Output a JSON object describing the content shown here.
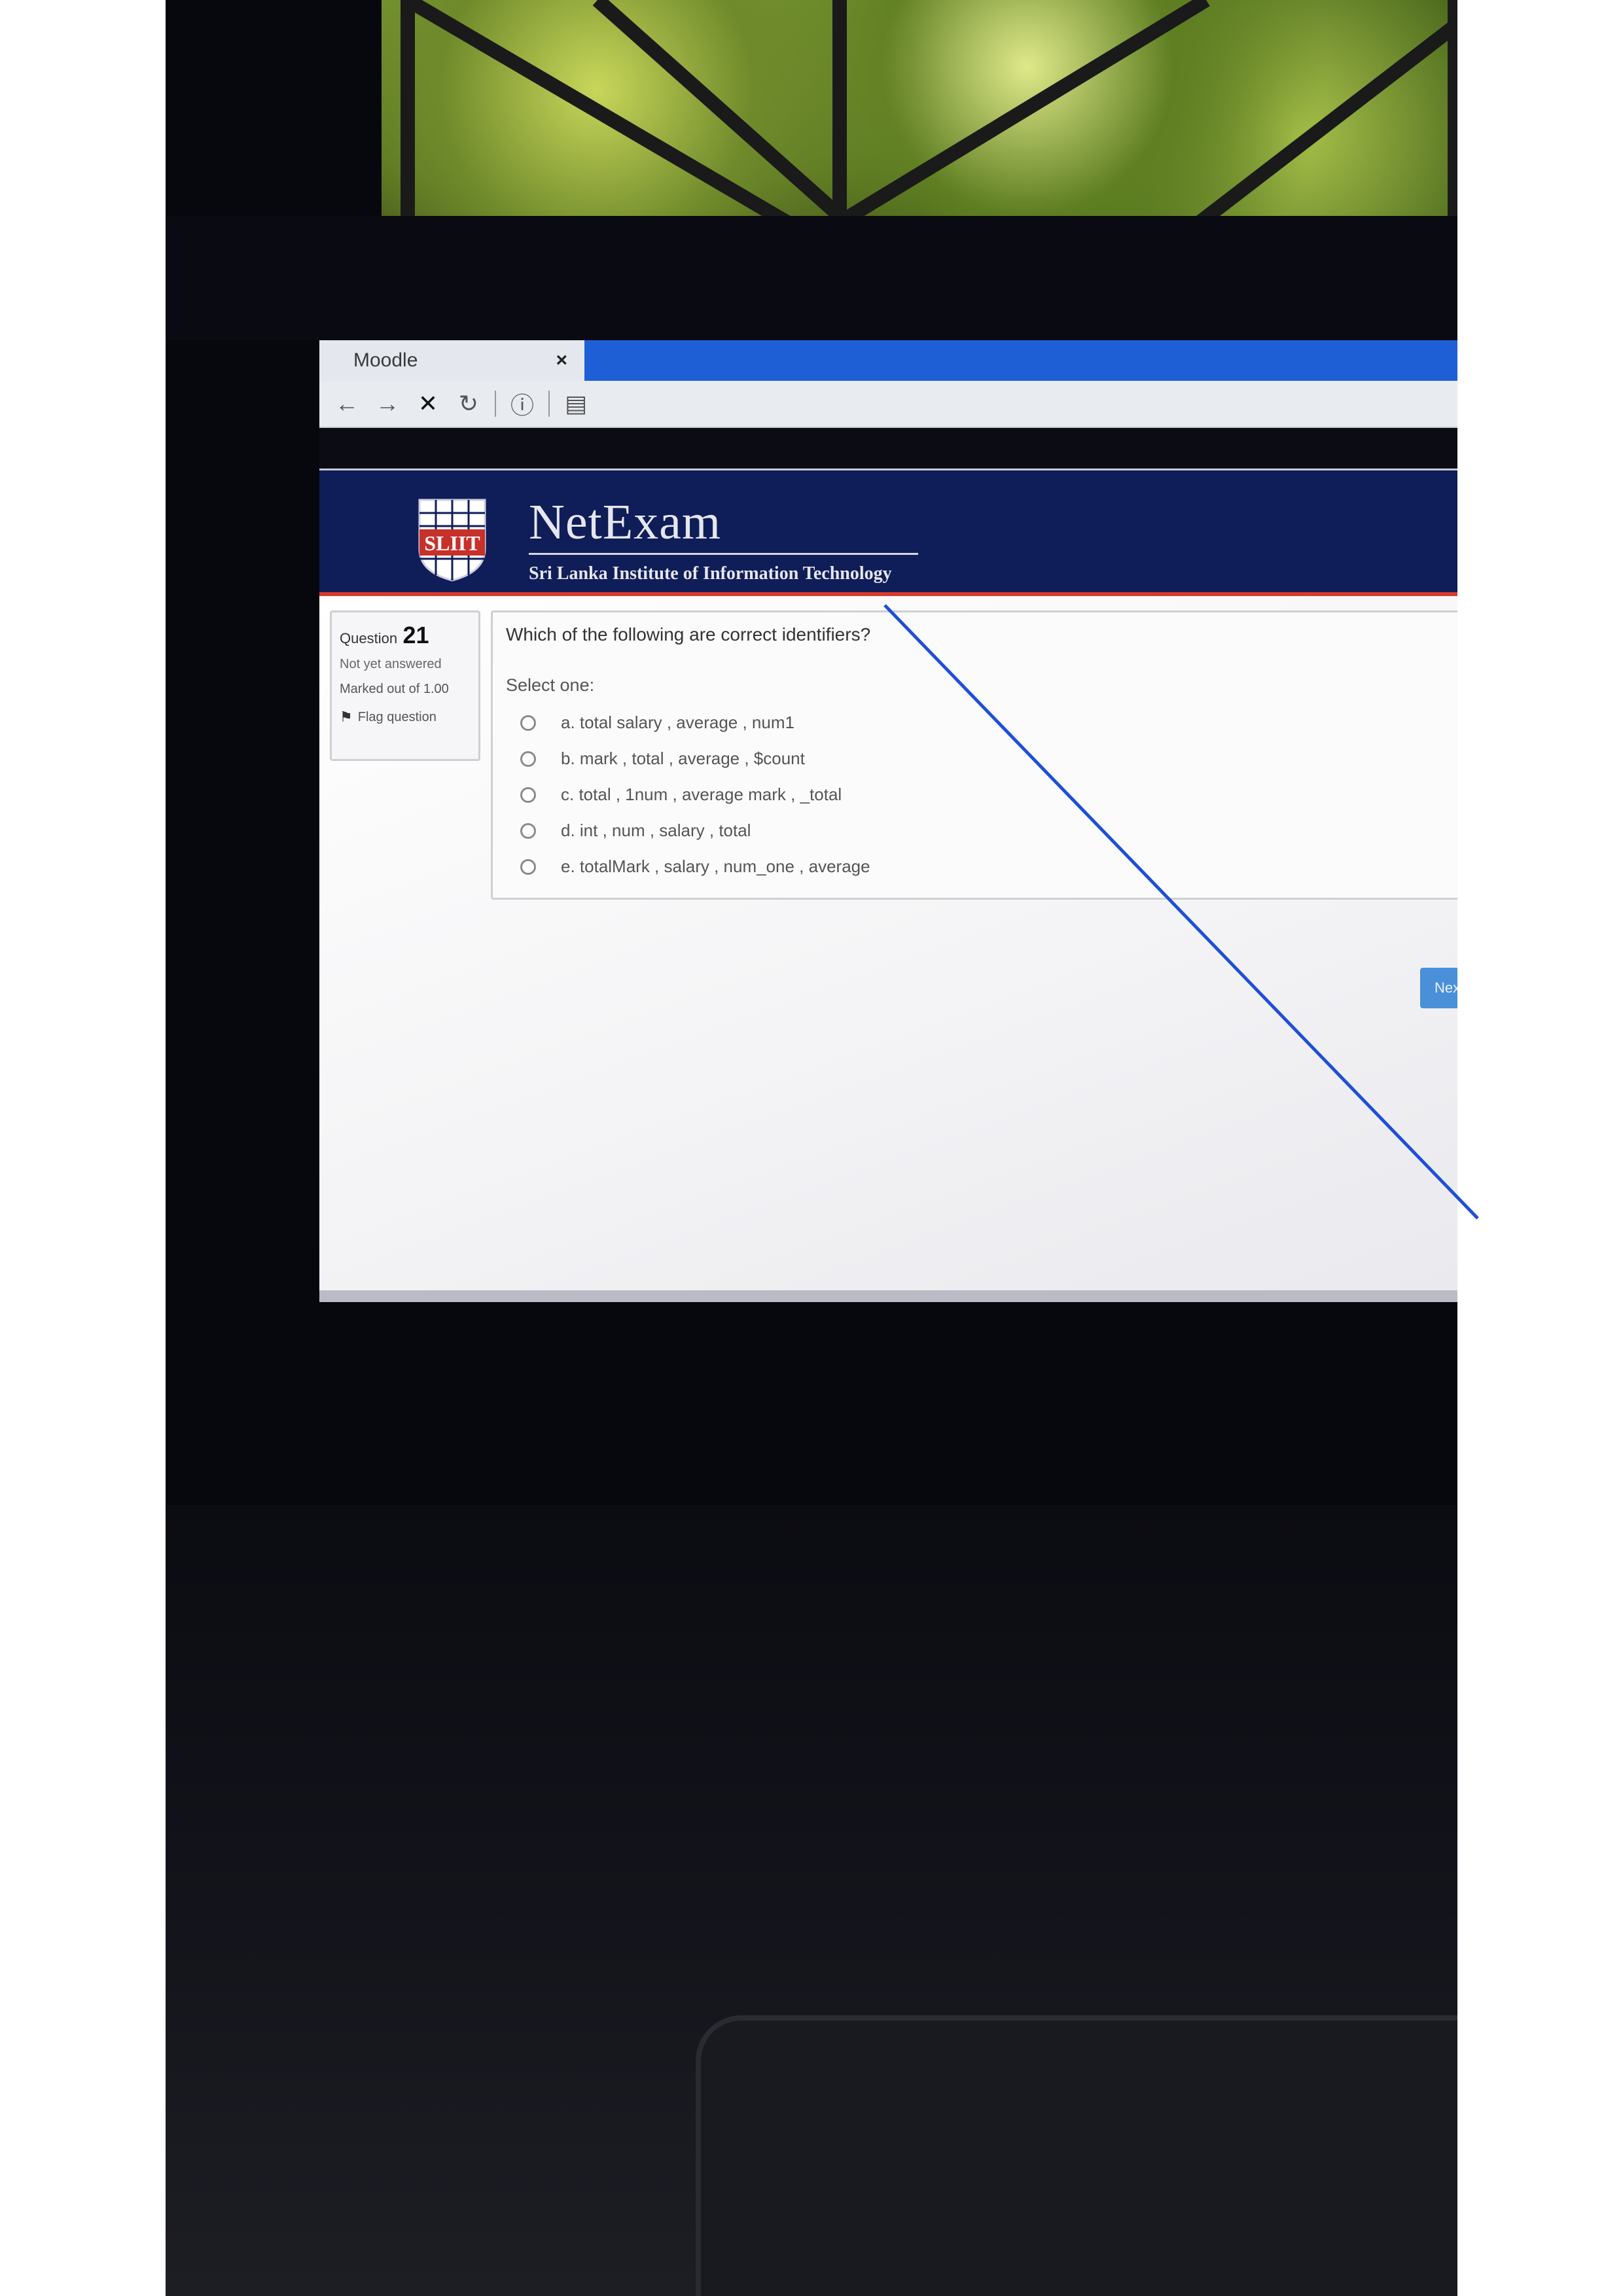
{
  "browser": {
    "tab_title": "Moodle",
    "tab_close": "×",
    "toolbar": {
      "back_icon": "←",
      "forward_icon": "→",
      "stop_icon": "✕",
      "reload_icon": "↻",
      "info_icon": "ⓘ",
      "page_icon": "▤"
    }
  },
  "header": {
    "brand_name": "NetExam",
    "subtitle": "Sri Lanka Institute of Information Technology",
    "logo_text": "SLIIT"
  },
  "question_info": {
    "label": "Question",
    "number": "21",
    "state": "Not yet answered",
    "marked": "Marked out of 1.00",
    "flag_label": "Flag question"
  },
  "question": {
    "text": "Which of the following are correct identifiers?",
    "prompt": "Select one:",
    "answers": [
      "a. total salary , average , num1",
      "b. mark , total , average , $count",
      "c. total , 1num , average mark , _total",
      "d. int , num , salary , total",
      "e. totalMark , salary , num_one , average"
    ]
  },
  "navigation": {
    "next_label": "Next"
  },
  "colors": {
    "tabbar": "#1f5fd6",
    "header_bg": "#0f1e58",
    "header_accent": "#d83a2a",
    "next_button": "#4a90d9",
    "pen_line": "#1e4fd8"
  }
}
